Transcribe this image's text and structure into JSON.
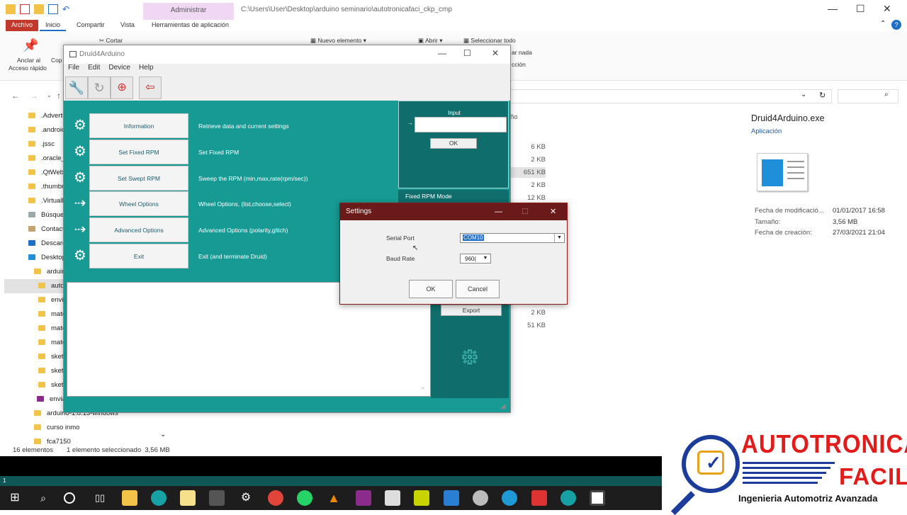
{
  "explorer": {
    "title_path": "C:\\Users\\User\\Desktop\\arduino seminario\\autotronicafaci_ckp_cmp",
    "context_tab": "Administrar",
    "tabs": [
      "Archivo",
      "Inicio",
      "Compartir",
      "Vista",
      "Herramientas de aplicación"
    ],
    "ribbon": {
      "pin": "Anclar al",
      "pin2": "Acceso rápido",
      "copy": "Cop",
      "cut": "Cortar",
      "new_item": "Nuevo elemento",
      "open": "Abrir",
      "select_all": "Seleccionar todo",
      "select_none": "ar nada",
      "invert": "cción"
    },
    "tree": [
      ".Advertis",
      ".android",
      ".jssc",
      ".oracle_",
      ".QtWeb",
      ".thumbr",
      ".VirtualE",
      "Búsque",
      "Contact",
      "Descarg",
      "Desktop",
      "arduin",
      "auto",
      "envia",
      "mate",
      "mate",
      "mate",
      "sketo",
      "sketo",
      "sketo",
      "envia",
      "arduino-1.8.13-windows",
      "curso inmo",
      "fca7150"
    ],
    "column_header": "ño",
    "sizes": [
      "6 KB",
      "2 KB",
      "651 KB",
      "2 KB",
      "12 KB",
      "2 KB",
      "51 KB"
    ],
    "details": {
      "filename": "Druid4Arduino.exe",
      "type": "Aplicación",
      "modified_label": "Fecha de modificació...",
      "modified_value": "01/01/2017 16:58",
      "size_label": "Tamaño:",
      "size_value": "3,56 MB",
      "created_label": "Fecha de creación:",
      "created_value": "27/03/2021 21:04"
    },
    "status_count": "16 elementos",
    "status_selected": "1 elemento seleccionado  3,56 MB",
    "cmd_line": "1"
  },
  "druid": {
    "title": "Druid4Arduino",
    "menu": [
      "File",
      "Edit",
      "Device",
      "Help"
    ],
    "items": [
      {
        "label": "Information",
        "desc": "Retrieve data and current settings",
        "icon": "gear-icon"
      },
      {
        "label": "Set Fixed RPM",
        "desc": "Set Fixed RPM",
        "icon": "gear-icon"
      },
      {
        "label": "Set Swept RPM",
        "desc": "Sweep the RPM (min,max,rate(rpm/sec))",
        "icon": "gear-icon"
      },
      {
        "label": "Wheel Options",
        "desc": "Wheel Options, (list,choose,select)",
        "icon": "arrow-icon"
      },
      {
        "label": "Advanced Options",
        "desc": "Advanced Options (polarity,glitch)",
        "icon": "arrow-icon"
      },
      {
        "label": "Exit",
        "desc": "Exit (and terminate Druid)",
        "icon": "gear-icon"
      }
    ],
    "input_label": "Input",
    "input_prefix": "→",
    "ok_label": "OK",
    "fixed_rpm_label": "Fixed RPM Mode",
    "export_label": "Export"
  },
  "settings": {
    "title": "Settings",
    "serial_port_label": "Serial Port",
    "serial_port_value": "COM10",
    "baud_rate_label": "Baud Rate",
    "baud_rate_value": "960(",
    "ok": "OK",
    "cancel": "Cancel"
  },
  "logo": {
    "line1": "AUTOTRONICA",
    "line2": "FACIL",
    "subtitle": "Ingenieria Automotriz Avanzada",
    "colors": {
      "red": "#e21b1b",
      "blue": "#1b3c9a"
    }
  }
}
